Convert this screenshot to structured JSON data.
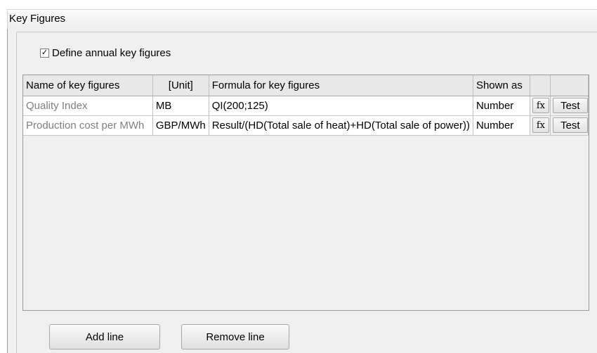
{
  "panel": {
    "title": "Key Figures"
  },
  "annual": {
    "label": "Define annual key figures",
    "checked": true,
    "check_glyph": "✓"
  },
  "grid": {
    "columns": [
      "Name of key figures",
      "[Unit]",
      "Formula for key figures",
      "Shown as",
      "",
      ""
    ],
    "rows": [
      {
        "name": "Quality Index",
        "unit": "MB",
        "formula": "QI(200;125)",
        "shown_as": "Number",
        "fx_label": "fx",
        "test_label": "Test"
      },
      {
        "name": "Production cost per MWh",
        "unit": "GBP/MWh",
        "formula": "Result/(HD(Total sale of heat)+HD(Total sale of power))",
        "shown_as": "Number",
        "fx_label": "fx",
        "test_label": "Test"
      }
    ]
  },
  "buttons": {
    "add_line": "Add line",
    "remove_line": "Remove line"
  },
  "icons": {
    "checkbox": "checkmark-icon",
    "formula": "fx-icon"
  }
}
